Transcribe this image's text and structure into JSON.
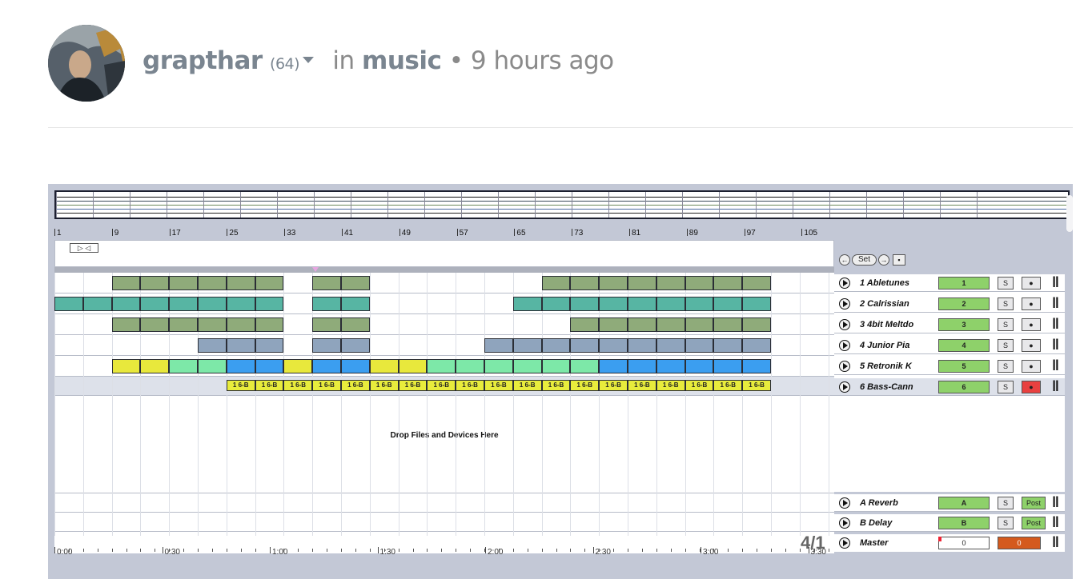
{
  "post": {
    "author": "grapthar",
    "reputation": "(64)",
    "in_label": "in",
    "category": "music",
    "bullet": "•",
    "time": "9 hours ago"
  },
  "daw": {
    "ruler_bars": [
      "1",
      "9",
      "17",
      "25",
      "33",
      "41",
      "49",
      "57",
      "65",
      "73",
      "81",
      "89",
      "97",
      "105"
    ],
    "loop_button": "▷ ◁",
    "set_controls": {
      "prev": "←",
      "set": "Set",
      "next": "→",
      "lock": "▪"
    },
    "drop_text": "Drop Files and Devices Here",
    "time_labels": [
      "0:00",
      "0:30",
      "1:00",
      "1:30",
      "2:00",
      "2:30",
      "3:00",
      "3:30"
    ],
    "time_signature": "4/1",
    "clip_label": "1 6-B",
    "colors": {
      "green": "#8fab7a",
      "teal": "#57b5a3",
      "steel": "#8fa4bd",
      "yellow": "#e8e83c",
      "mint": "#7de8a8",
      "blue": "#3b9ef0",
      "bright": "#e8ec3c",
      "arm": "#8ed16a",
      "record": "#e84040"
    },
    "tracks": [
      {
        "name": "1 Abletunes",
        "activator": "1",
        "solo": "S",
        "arm": "●",
        "io": "ǁ"
      },
      {
        "name": "2 Calrissian",
        "activator": "2",
        "solo": "S",
        "arm": "●",
        "io": "ǁ"
      },
      {
        "name": "3 4bit Meltdo",
        "activator": "3",
        "solo": "S",
        "arm": "●",
        "io": "ǁ"
      },
      {
        "name": "4 Junior Pia",
        "activator": "4",
        "solo": "S",
        "arm": "●",
        "io": "ǁ"
      },
      {
        "name": "5 Retronik K",
        "activator": "5",
        "solo": "S",
        "arm": "●",
        "io": "ǁ"
      },
      {
        "name": "6 Bass-Cann",
        "activator": "6",
        "solo": "S",
        "arm": "●",
        "io": "ǁ"
      }
    ],
    "returns": [
      {
        "name": "A Reverb",
        "activator": "A",
        "solo": "S",
        "post": "Post",
        "io": "ǁ"
      },
      {
        "name": "B Delay",
        "activator": "B",
        "solo": "S",
        "post": "Post",
        "io": "ǁ"
      }
    ],
    "master": {
      "name": "Master",
      "cue": "0",
      "volume": "0",
      "io": "ǁ"
    }
  }
}
